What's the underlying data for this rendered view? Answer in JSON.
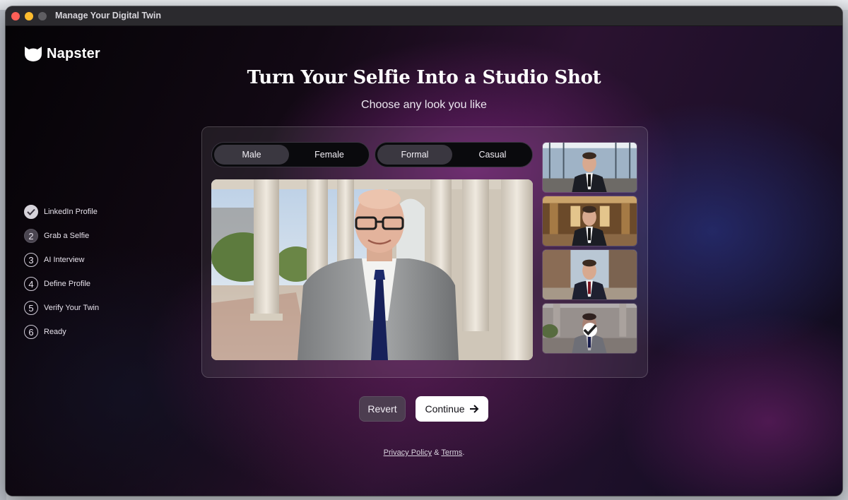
{
  "window": {
    "title": "Manage Your Digital Twin"
  },
  "brand": {
    "name": "Napster"
  },
  "header": {
    "title": "Turn Your Selfie Into a Studio Shot",
    "subtitle": "Choose any look you like"
  },
  "steps": [
    {
      "num": "✓",
      "label": "LinkedIn Profile",
      "state": "done"
    },
    {
      "num": "2",
      "label": "Grab a Selfie",
      "state": "active"
    },
    {
      "num": "3",
      "label": "AI Interview",
      "state": "pending"
    },
    {
      "num": "4",
      "label": "Define Profile",
      "state": "pending"
    },
    {
      "num": "5",
      "label": "Verify Your Twin",
      "state": "pending"
    },
    {
      "num": "6",
      "label": "Ready",
      "state": "pending"
    }
  ],
  "gender_toggle": {
    "options": [
      "Male",
      "Female"
    ],
    "selected": "Male"
  },
  "style_toggle": {
    "options": [
      "Formal",
      "Casual"
    ],
    "selected": "Formal"
  },
  "thumbnails": [
    {
      "scene": "office",
      "selected": false
    },
    {
      "scene": "hall",
      "selected": false
    },
    {
      "scene": "street",
      "selected": false
    },
    {
      "scene": "courtyard",
      "selected": true
    }
  ],
  "buttons": {
    "revert": "Revert",
    "continue": "Continue"
  },
  "footer": {
    "privacy": "Privacy Policy",
    "and": "&",
    "terms": "Terms",
    "period": "."
  },
  "colors": {
    "accent": "#ffffff",
    "background": "#2b1230",
    "selected_option": "#3a3740"
  }
}
